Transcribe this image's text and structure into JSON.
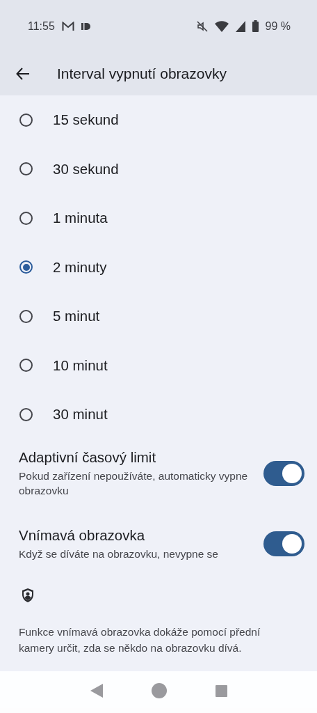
{
  "status_bar": {
    "time": "11:55",
    "battery": "99 %"
  },
  "header": {
    "title": "Interval vypnutí obrazovky"
  },
  "options": [
    {
      "label": "15 sekund",
      "selected": false
    },
    {
      "label": "30 sekund",
      "selected": false
    },
    {
      "label": "1 minuta",
      "selected": false
    },
    {
      "label": "2 minuty",
      "selected": true
    },
    {
      "label": "5 minut",
      "selected": false
    },
    {
      "label": "10 minut",
      "selected": false
    },
    {
      "label": "30 minut",
      "selected": false
    }
  ],
  "toggles": [
    {
      "title": "Adaptivní časový limit",
      "summary": "Pokud zařízení nepoužíváte, automaticky vypne obrazovku",
      "on": true
    },
    {
      "title": "Vnímavá obrazovka",
      "summary": "Když se díváte na obrazovku, nevypne se",
      "on": true
    }
  ],
  "footer": {
    "text": "Funkce vnímavá obrazovka dokáže pomocí přední kamery určit, zda se někdo na obrazovku dívá."
  }
}
